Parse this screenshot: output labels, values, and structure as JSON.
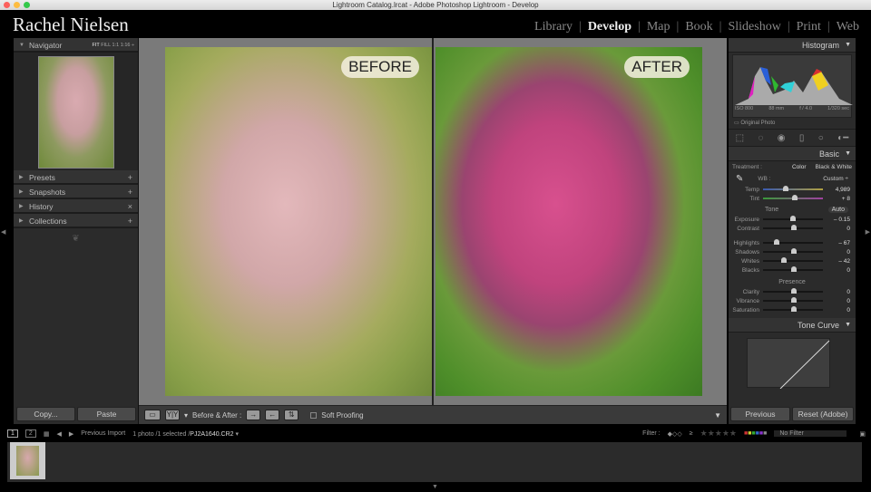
{
  "window": {
    "title": "Lightroom Catalog.lrcat - Adobe Photoshop Lightroom - Develop"
  },
  "brand": "Rachel Nielsen",
  "modules": [
    "Library",
    "Develop",
    "Map",
    "Book",
    "Slideshow",
    "Print",
    "Web"
  ],
  "active_module": "Develop",
  "navigator": {
    "title": "Navigator",
    "zoom_options": [
      "FIT",
      "FILL",
      "1:1",
      "1:16 ÷"
    ]
  },
  "left_panels": [
    {
      "label": "Presets",
      "action": "+"
    },
    {
      "label": "Snapshots",
      "action": "+"
    },
    {
      "label": "History",
      "action": "×"
    },
    {
      "label": "Collections",
      "action": "+"
    }
  ],
  "left_buttons": {
    "copy": "Copy...",
    "paste": "Paste"
  },
  "view": {
    "before_label": "BEFORE",
    "after_label": "AFTER"
  },
  "toolbar": {
    "view_mode": "Y|Y",
    "before_after_label": "Before & After :",
    "soft_proofing": "Soft Proofing"
  },
  "histogram": {
    "title": "Histogram",
    "iso": "ISO 800",
    "focal": "88 mm",
    "aperture": "f / 4.0",
    "shutter": "1/320 sec",
    "original_photo": "Original Photo"
  },
  "basic": {
    "title": "Basic",
    "treatment_label": "Treatment :",
    "treatment_color": "Color",
    "treatment_bw": "Black & White",
    "wb_label": "WB :",
    "wb_value": "Custom ÷",
    "tone_label": "Tone",
    "auto_label": "Auto",
    "presence_label": "Presence",
    "wb_sliders": [
      {
        "name": "Temp",
        "value": "4,989",
        "pos": 0.35
      },
      {
        "name": "Tint",
        "value": "+ 8",
        "pos": 0.52
      }
    ],
    "tone_sliders": [
      {
        "name": "Exposure",
        "value": "– 0.15",
        "pos": 0.49
      },
      {
        "name": "Contrast",
        "value": "0",
        "pos": 0.5
      }
    ],
    "tone_sliders2": [
      {
        "name": "Highlights",
        "value": "– 67",
        "pos": 0.2
      },
      {
        "name": "Shadows",
        "value": "0",
        "pos": 0.5
      },
      {
        "name": "Whites",
        "value": "– 42",
        "pos": 0.32
      },
      {
        "name": "Blacks",
        "value": "0",
        "pos": 0.5
      }
    ],
    "presence_sliders": [
      {
        "name": "Clarity",
        "value": "0",
        "pos": 0.5
      },
      {
        "name": "Vibrance",
        "value": "0",
        "pos": 0.5
      },
      {
        "name": "Saturation",
        "value": "0",
        "pos": 0.5
      }
    ]
  },
  "tone_curve": {
    "title": "Tone Curve"
  },
  "right_buttons": {
    "previous": "Previous",
    "reset": "Reset (Adobe)"
  },
  "filmstrip": {
    "screen1": "1",
    "screen2": "2",
    "source": "Previous Import",
    "info": "1 photo /1 selected /",
    "filename": "PJ2A1640.CR2",
    "filter_label": "Filter :",
    "rating_op": "≥",
    "stars": "★★★★★",
    "filter_value": "No Filter"
  },
  "colors": {
    "accent": "#eeeeee",
    "panel": "#2b2b2b"
  }
}
